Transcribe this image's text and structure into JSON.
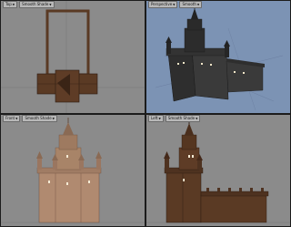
{
  "viewports": {
    "top": {
      "view_label": "Top",
      "mode_label": "Smooth Shade"
    },
    "persp": {
      "view_label": "Perspective",
      "mode_label": "Smooth"
    },
    "front": {
      "view_label": "Front",
      "mode_label": "Smooth Shade"
    },
    "left": {
      "view_label": "Left",
      "mode_label": "Smooth Shade"
    }
  },
  "icons": {
    "dropdown": "chevron-down-icon"
  },
  "colors": {
    "viewport_bg": "#8b8b8b",
    "perspective_bg": "#7c93b4",
    "model_brown": "#5a3a24",
    "model_tan": "#b08a70",
    "model_dark": "#2e2e2e"
  }
}
